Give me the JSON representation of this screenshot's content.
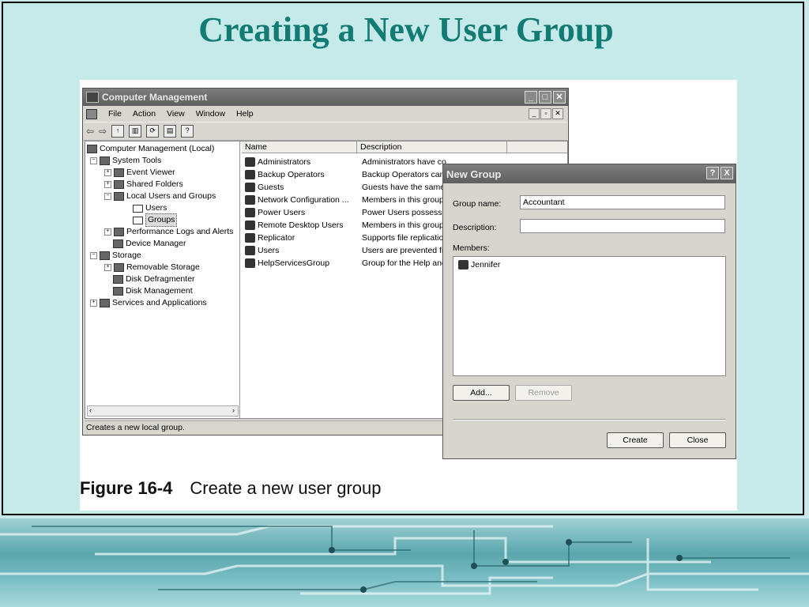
{
  "slide": {
    "title": "Creating a New User Group",
    "caption_number": "Figure 16-4",
    "caption_text": "Create a new user group"
  },
  "cm_window": {
    "title": "Computer Management",
    "menu": [
      "File",
      "Action",
      "View",
      "Window",
      "Help"
    ],
    "tree": [
      {
        "label": "Computer Management (Local)",
        "level": 0
      },
      {
        "label": "System Tools",
        "level": 1
      },
      {
        "label": "Event Viewer",
        "level": 2
      },
      {
        "label": "Shared Folders",
        "level": 2
      },
      {
        "label": "Local Users and Groups",
        "level": 2
      },
      {
        "label": "Users",
        "level": 3
      },
      {
        "label": "Groups",
        "level": 3
      },
      {
        "label": "Performance Logs and Alerts",
        "level": 2
      },
      {
        "label": "Device Manager",
        "level": 2
      },
      {
        "label": "Storage",
        "level": 1
      },
      {
        "label": "Removable Storage",
        "level": 2
      },
      {
        "label": "Disk Defragmenter",
        "level": 2
      },
      {
        "label": "Disk Management",
        "level": 2
      },
      {
        "label": "Services and Applications",
        "level": 1
      }
    ],
    "columns": {
      "name": "Name",
      "description": "Description"
    },
    "rows": [
      {
        "name": "Administrators",
        "description": "Administrators have co"
      },
      {
        "name": "Backup Operators",
        "description": "Backup Operators can"
      },
      {
        "name": "Guests",
        "description": "Guests have the same"
      },
      {
        "name": "Network Configuration ...",
        "description": "Members in this group"
      },
      {
        "name": "Power Users",
        "description": "Power Users possess r"
      },
      {
        "name": "Remote Desktop Users",
        "description": "Members in this group"
      },
      {
        "name": "Replicator",
        "description": "Supports file replication"
      },
      {
        "name": "Users",
        "description": "Users are prevented fi"
      },
      {
        "name": "HelpServicesGroup",
        "description": "Group for the Help and"
      }
    ],
    "status": "Creates a new local group."
  },
  "dialog": {
    "title": "New Group",
    "help_btn": "?",
    "close_btn": "X",
    "group_name_label": "Group name:",
    "group_name_value": "Accountant",
    "description_label": "Description:",
    "description_value": "",
    "members_label": "Members:",
    "members": [
      "Jennifer"
    ],
    "add_label": "Add...",
    "remove_label": "Remove",
    "create_label": "Create",
    "close_label": "Close"
  }
}
